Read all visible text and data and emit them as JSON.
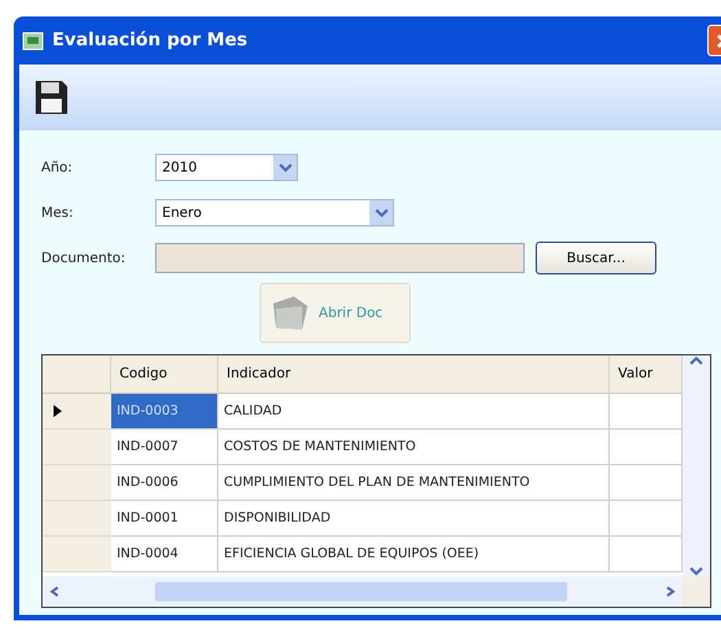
{
  "window": {
    "title": "Evaluación por Mes"
  },
  "form": {
    "year_label": "Año:",
    "year": "2010",
    "month_label": "Mes:",
    "month": "Enero",
    "document_label": "Documento:",
    "document_disabled": true,
    "search_button": "Buscar...",
    "open_button": "Abrir Doc"
  },
  "table": {
    "columns": [
      "Codigo",
      "Indicador",
      "Valor"
    ],
    "rows": [
      {
        "codigo": "IND-0003",
        "indicador": "CALIDAD",
        "selected": true
      },
      {
        "codigo": "IND-0007",
        "indicador": "COSTOS DE MANTENIMIENTO",
        "selected": false
      },
      {
        "codigo": "IND-0006",
        "indicador": "CUMPLIMIENTO DEL PLAN DE MANTENIMIENTO",
        "selected": false
      },
      {
        "codigo": "IND-0001",
        "indicador": "DISPONIBILIDAD",
        "selected": false
      },
      {
        "codigo": "IND-0004",
        "indicador": "EFICIENCIA GLOBAL DE EQUIPOS (OEE)",
        "selected": false
      }
    ]
  }
}
